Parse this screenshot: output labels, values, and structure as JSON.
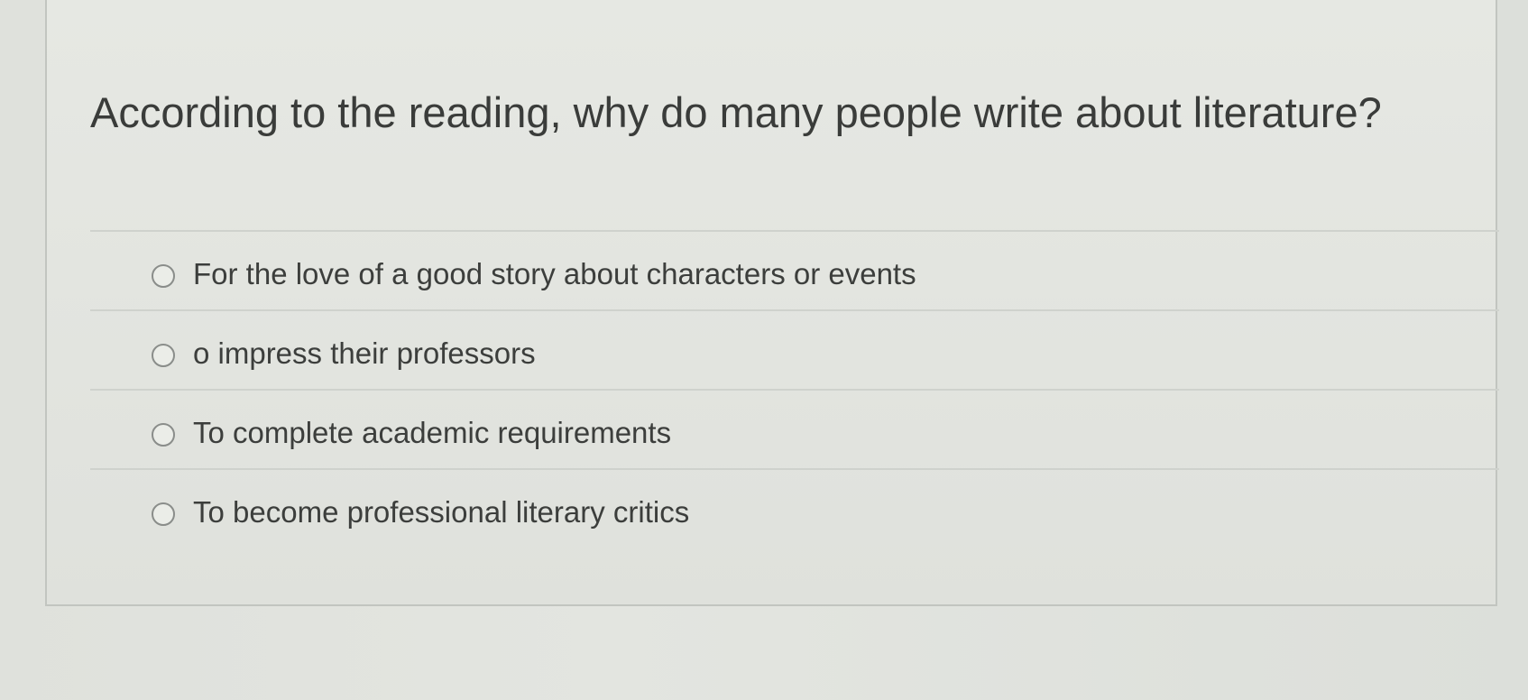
{
  "question": {
    "text": "According to the reading, why do many people write about literature?"
  },
  "options": [
    {
      "label": "For the love of a good story about characters or events",
      "selected": false
    },
    {
      "label": "o impress their professors",
      "selected": false
    },
    {
      "label": "To complete academic requirements",
      "selected": false
    },
    {
      "label": "To become professional literary critics",
      "selected": false
    }
  ],
  "icons": {
    "radio": "radio-unchecked-icon"
  },
  "colors": {
    "background": "#dfe1dc",
    "text": "#3a3c3a",
    "divider": "#cfd2cd",
    "radio_border": "#8a8d8a"
  }
}
